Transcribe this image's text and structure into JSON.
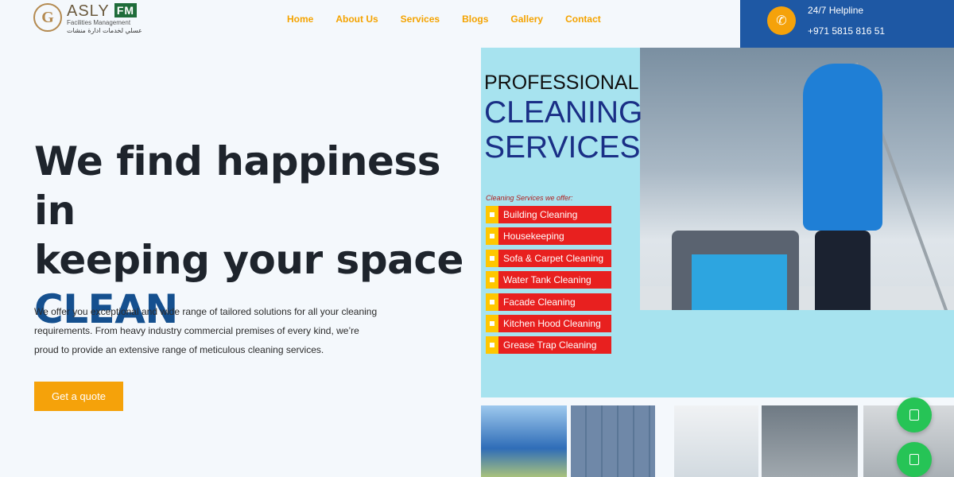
{
  "header": {
    "logo": {
      "brand": "ASLY",
      "badge": "FM",
      "subtitle": "Facilities Management",
      "arabic": "عسلي لخدمات ادارة منشات",
      "emblem_letter": "G"
    },
    "nav": [
      "Home",
      "About Us",
      "Services",
      "Blogs",
      "Gallery",
      "Contact"
    ],
    "helpline": {
      "title": "24/7 Helpline",
      "number": "+971 5815 816 51",
      "icon": "phone-icon"
    }
  },
  "hero": {
    "title_line1": "We find happiness in",
    "title_line2": "keeping your space",
    "title_accent": "CLEAN",
    "description": "We offer you exceptional and wide range of tailored solutions for all your cleaning requirements. From heavy industry commercial premises of every kind, we’re proud to provide an extensive range of meticulous cleaning services.",
    "cta": "Get a quote"
  },
  "banner": {
    "line1": "PROFESSIONAL",
    "line2": "CLEANING",
    "line3": "SERVICES",
    "offer_label": "Cleaning Services we offer:",
    "services": [
      "Building Cleaning",
      "Housekeeping",
      "Sofa & Carpet Cleaning",
      "Water Tank Cleaning",
      "Facade Cleaning",
      "Kitchen Hood Cleaning",
      "Grease Trap Cleaning"
    ]
  },
  "floating_buttons": [
    "chat-icon",
    "chat-icon"
  ],
  "colors": {
    "accent_orange": "#f5a20a",
    "brand_blue": "#1e58a4",
    "title_blue": "#15508f",
    "whatsapp_green": "#26c456",
    "service_red": "#e8201f"
  }
}
